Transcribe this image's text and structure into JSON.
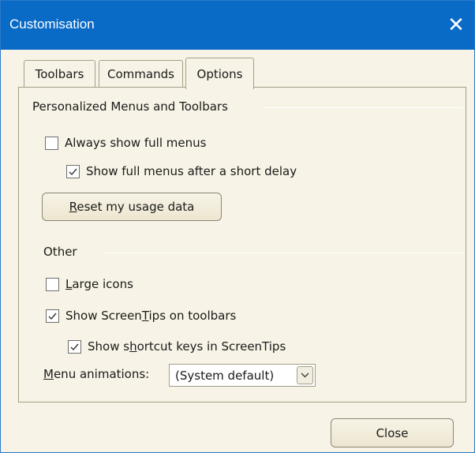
{
  "window": {
    "title": "Customisation",
    "close_glyph": "✕"
  },
  "tabs": [
    {
      "label": "Toolbars",
      "active": false
    },
    {
      "label": "Commands",
      "active": false
    },
    {
      "label": "Options",
      "active": true
    }
  ],
  "personalized": {
    "heading": "Personalized Menus and Toolbars",
    "always_show_full_menus": {
      "pre": "",
      "accel": "",
      "post": "Always show full menus",
      "checked": false
    },
    "show_after_delay": {
      "pre": "",
      "accel": "",
      "post": "Show full menus after a short delay",
      "checked": true
    },
    "reset_button": {
      "pre": "",
      "accel": "R",
      "post": "eset my usage data"
    }
  },
  "other": {
    "heading": "Other",
    "large_icons": {
      "pre": "",
      "accel": "L",
      "post": "arge icons",
      "checked": false
    },
    "show_screentips": {
      "pre": "Show Screen",
      "accel": "T",
      "post": "ips on toolbars",
      "checked": true
    },
    "show_shortcut_keys": {
      "pre": "Show s",
      "accel": "h",
      "post": "ortcut keys in ScreenTips",
      "checked": true
    },
    "menu_animations": {
      "label_pre": "",
      "label_accel": "M",
      "label_post": "enu animations:",
      "selected": "(System default)"
    }
  },
  "footer": {
    "close_label": "Close"
  },
  "icons": {
    "check": "check-icon",
    "dropdown": "chevron-down-icon",
    "close": "close-icon"
  },
  "colors": {
    "titlebar": "#0a6bc7",
    "dialog_bg": "#f7f3e6",
    "border": "#a59f88"
  }
}
